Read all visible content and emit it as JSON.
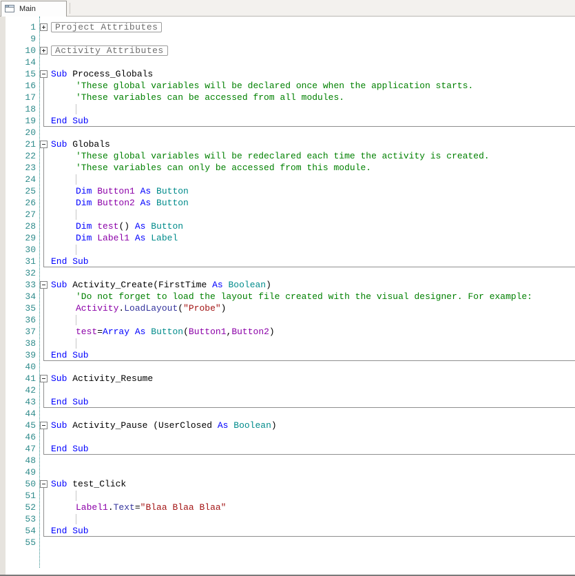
{
  "tab": {
    "label": "Main"
  },
  "colors": {
    "keyword": "#0000FF",
    "type": "#008B8B",
    "comment": "#008000",
    "string": "#A31515",
    "identifier": "#8B00A8",
    "member": "#33339C",
    "plain": "#000000",
    "line_number": "#2E8B8B",
    "fold_line": "#8E8E8E",
    "region_text": "#6E6E6E",
    "region_border": "#9C9C9C",
    "gutter_dots": "#2E8B8B",
    "margin_strip": "#E6E3DE"
  },
  "editor": {
    "fold_spans": [
      [
        15,
        19
      ],
      [
        21,
        31
      ],
      [
        33,
        39
      ],
      [
        41,
        43
      ],
      [
        45,
        47
      ],
      [
        50,
        54
      ]
    ],
    "lines": [
      {
        "n": 1,
        "fold": "plus",
        "region": "Project Attributes"
      },
      {
        "n": 9
      },
      {
        "n": 10,
        "fold": "plus",
        "region": "Activity Attributes"
      },
      {
        "n": 14
      },
      {
        "n": 15,
        "fold": "minus",
        "tokens": [
          [
            "kw",
            "Sub "
          ],
          [
            "plain",
            "Process_Globals"
          ]
        ]
      },
      {
        "n": 16,
        "indent": 1,
        "tokens": [
          [
            "comment",
            "'These global variables will be declared once when the application starts."
          ]
        ]
      },
      {
        "n": 17,
        "indent": 1,
        "tokens": [
          [
            "comment",
            "'These variables can be accessed from all modules."
          ]
        ]
      },
      {
        "n": 18,
        "guide": true
      },
      {
        "n": 19,
        "rule": true,
        "tokens": [
          [
            "kw",
            "End Sub"
          ]
        ]
      },
      {
        "n": 20
      },
      {
        "n": 21,
        "fold": "minus",
        "tokens": [
          [
            "kw",
            "Sub "
          ],
          [
            "plain",
            "Globals"
          ]
        ]
      },
      {
        "n": 22,
        "indent": 1,
        "tokens": [
          [
            "comment",
            "'These global variables will be redeclared each time the activity is created."
          ]
        ]
      },
      {
        "n": 23,
        "indent": 1,
        "tokens": [
          [
            "comment",
            "'These variables can only be accessed from this module."
          ]
        ]
      },
      {
        "n": 24,
        "guide": true
      },
      {
        "n": 25,
        "indent": 1,
        "tokens": [
          [
            "kw",
            "Dim "
          ],
          [
            "var",
            "Button1"
          ],
          [
            "kw",
            " As "
          ],
          [
            "type",
            "Button"
          ]
        ]
      },
      {
        "n": 26,
        "indent": 1,
        "tokens": [
          [
            "kw",
            "Dim "
          ],
          [
            "var",
            "Button2"
          ],
          [
            "kw",
            " As "
          ],
          [
            "type",
            "Button"
          ]
        ]
      },
      {
        "n": 27,
        "guide": true
      },
      {
        "n": 28,
        "indent": 1,
        "tokens": [
          [
            "kw",
            "Dim "
          ],
          [
            "var",
            "test"
          ],
          [
            "plain",
            "()"
          ],
          [
            "kw",
            " As "
          ],
          [
            "type",
            "Button"
          ]
        ]
      },
      {
        "n": 29,
        "indent": 1,
        "tokens": [
          [
            "kw",
            "Dim "
          ],
          [
            "var",
            "Label1"
          ],
          [
            "kw",
            " As "
          ],
          [
            "type",
            "Label"
          ]
        ]
      },
      {
        "n": 30,
        "guide": true
      },
      {
        "n": 31,
        "rule": true,
        "tokens": [
          [
            "kw",
            "End Sub"
          ]
        ]
      },
      {
        "n": 32
      },
      {
        "n": 33,
        "fold": "minus",
        "tokens": [
          [
            "kw",
            "Sub "
          ],
          [
            "plain",
            "Activity_Create(FirstTime"
          ],
          [
            "kw",
            " As "
          ],
          [
            "type",
            "Boolean"
          ],
          [
            "plain",
            ")"
          ]
        ]
      },
      {
        "n": 34,
        "indent": 1,
        "tokens": [
          [
            "comment",
            "'Do not forget to load the layout file created with the visual designer. For example:"
          ]
        ]
      },
      {
        "n": 35,
        "indent": 1,
        "tokens": [
          [
            "var",
            "Activity"
          ],
          [
            "plain",
            "."
          ],
          [
            "member",
            "LoadLayout"
          ],
          [
            "plain",
            "("
          ],
          [
            "str",
            "\"Probe\""
          ],
          [
            "plain",
            ")"
          ]
        ]
      },
      {
        "n": 36,
        "guide": true
      },
      {
        "n": 37,
        "indent": 1,
        "tokens": [
          [
            "var",
            "test"
          ],
          [
            "plain",
            "="
          ],
          [
            "kw",
            "Array"
          ],
          [
            "kw",
            " As "
          ],
          [
            "type",
            "Button"
          ],
          [
            "plain",
            "("
          ],
          [
            "var",
            "Button1"
          ],
          [
            "plain",
            ","
          ],
          [
            "var",
            "Button2"
          ],
          [
            "plain",
            ")"
          ]
        ]
      },
      {
        "n": 38,
        "guide": true
      },
      {
        "n": 39,
        "rule": true,
        "tokens": [
          [
            "kw",
            "End Sub"
          ]
        ]
      },
      {
        "n": 40
      },
      {
        "n": 41,
        "fold": "minus",
        "tokens": [
          [
            "kw",
            "Sub "
          ],
          [
            "plain",
            "Activity_Resume"
          ]
        ]
      },
      {
        "n": 42
      },
      {
        "n": 43,
        "rule": true,
        "tokens": [
          [
            "kw",
            "End Sub"
          ]
        ]
      },
      {
        "n": 44
      },
      {
        "n": 45,
        "fold": "minus",
        "tokens": [
          [
            "kw",
            "Sub "
          ],
          [
            "plain",
            "Activity_Pause (UserClosed"
          ],
          [
            "kw",
            " As "
          ],
          [
            "type",
            "Boolean"
          ],
          [
            "plain",
            ")"
          ]
        ]
      },
      {
        "n": 46
      },
      {
        "n": 47,
        "rule": true,
        "tokens": [
          [
            "kw",
            "End Sub"
          ]
        ]
      },
      {
        "n": 48
      },
      {
        "n": 49
      },
      {
        "n": 50,
        "fold": "minus",
        "tokens": [
          [
            "kw",
            "Sub "
          ],
          [
            "plain",
            "test_Click"
          ]
        ]
      },
      {
        "n": 51,
        "guide": true
      },
      {
        "n": 52,
        "indent": 1,
        "tokens": [
          [
            "var",
            "Label1"
          ],
          [
            "plain",
            "."
          ],
          [
            "member",
            "Text"
          ],
          [
            "plain",
            "="
          ],
          [
            "str",
            "\"Blaa Blaa Blaa\""
          ]
        ]
      },
      {
        "n": 53,
        "guide": true
      },
      {
        "n": 54,
        "rule": true,
        "tokens": [
          [
            "kw",
            "End Sub"
          ]
        ]
      },
      {
        "n": 55
      }
    ]
  }
}
